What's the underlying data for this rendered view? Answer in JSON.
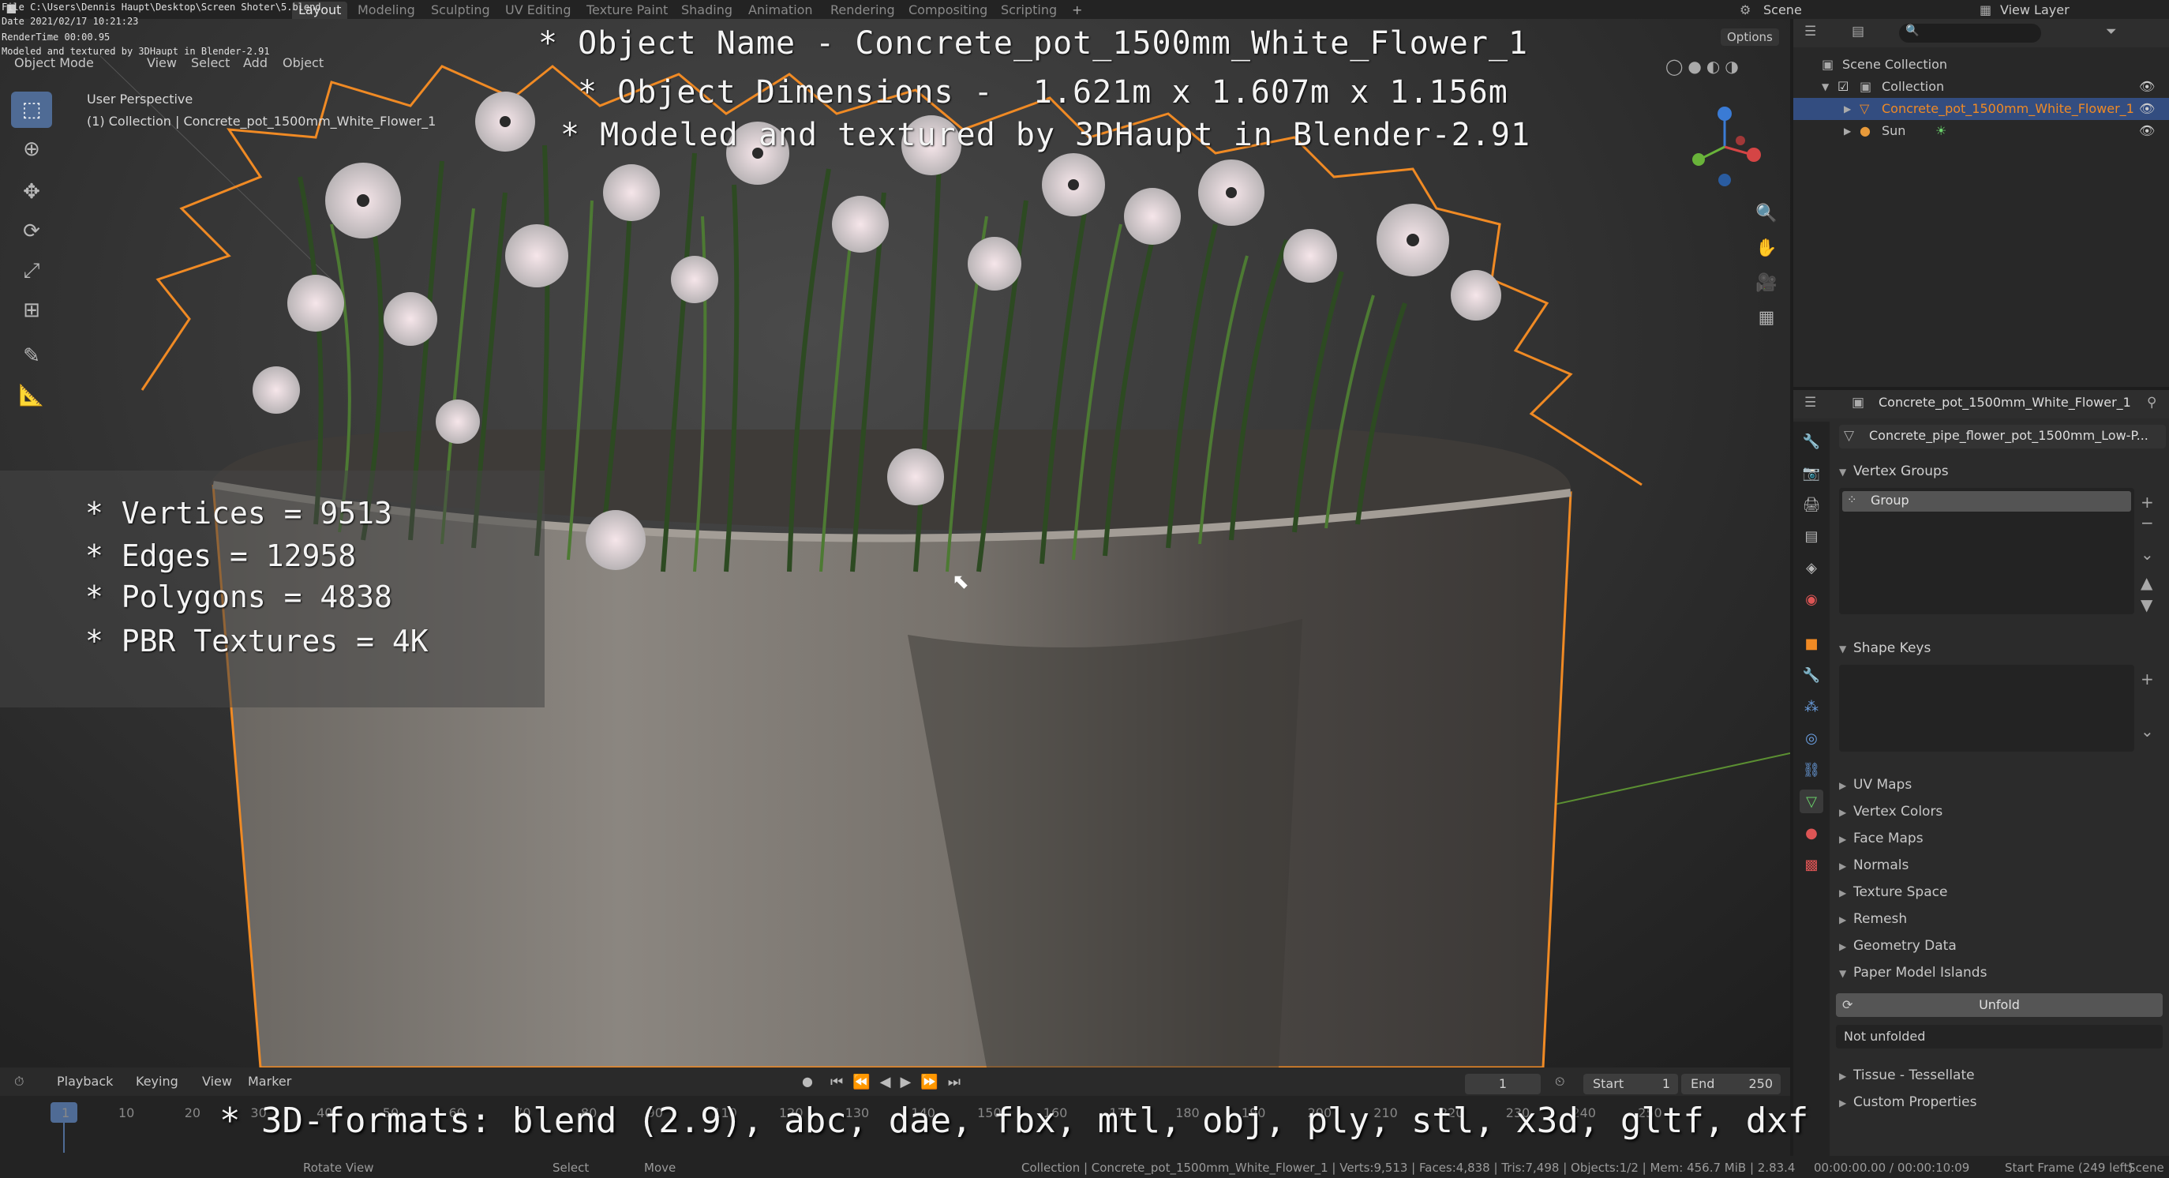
{
  "topbar": {
    "tabs": [
      "Layout",
      "Modeling",
      "Sculpting",
      "UV Editing",
      "Texture Paint",
      "Shading",
      "Animation",
      "Rendering",
      "Compositing",
      "Scripting"
    ],
    "active_tab": "Layout",
    "scene_label": "Scene",
    "view_layer_label": "View Layer"
  },
  "info_overlay": {
    "file": "File C:\\Users\\Dennis Haupt\\Desktop\\Screen Shoter\\5.blend",
    "date": "Date 2021/02/17 10:21:23",
    "render_time": "RenderTime 00:00.95",
    "credit": "Modeled and textured by 3DHaupt in Blender-2.91"
  },
  "viewport": {
    "mode": "Object Mode",
    "menus": [
      "View",
      "Select",
      "Add",
      "Object"
    ],
    "perspective": "User Perspective",
    "collection_path": "(1) Collection | Concrete_pot_1500mm_White_Flower_1",
    "options_label": "Options"
  },
  "overlay_title": {
    "line1": "* Object Name - Concrete_pot_1500mm_White_Flower_1",
    "line2": "* Object Dimensions -  1.621m x 1.607m x 1.156m",
    "line3": "* Modeled and textured by 3DHaupt in Blender-2.91"
  },
  "overlay_stats": {
    "vertices": "* Vertices = 9513",
    "edges": "* Edges = 12958",
    "polygons": "* Polygons = 4838",
    "textures": "* PBR Textures = 4K"
  },
  "overlay_formats": "* 3D-formats: blend (2.9), abc, dae, fbx, mtl, obj, ply, stl, x3d, gltf, dxf",
  "outliner": {
    "root": "Scene Collection",
    "collection": "Collection",
    "object": "Concrete_pot_1500mm_White_Flower_1",
    "light": "Sun"
  },
  "properties": {
    "object_name": "Concrete_pot_1500mm_White_Flower_1",
    "mesh_name": "Concrete_pipe_flower_pot_1500mm_Low-P...",
    "vertex_groups_label": "Vertex Groups",
    "vertex_group_item": "Group",
    "shape_keys_label": "Shape Keys",
    "collapsed_panels": [
      "UV Maps",
      "Vertex Colors",
      "Face Maps",
      "Normals",
      "Texture Space",
      "Remesh",
      "Geometry Data"
    ],
    "paper_model_label": "Paper Model Islands",
    "unfold_button": "Unfold",
    "unfold_status": "Not unfolded",
    "tissue_label": "Tissue - Tessellate",
    "custom_props_label": "Custom Properties"
  },
  "timeline": {
    "menus": [
      "Playback",
      "Keying",
      "View",
      "Marker"
    ],
    "current_frame": "1",
    "start_label": "Start",
    "start_value": "1",
    "end_label": "End",
    "end_value": "250",
    "ticks": [
      "1",
      "10",
      "20",
      "30",
      "40",
      "50",
      "60",
      "70",
      "80",
      "90",
      "110",
      "120",
      "130",
      "140",
      "150",
      "160",
      "170",
      "180",
      "190",
      "200",
      "210",
      "220",
      "230",
      "240",
      "250"
    ]
  },
  "statusbar": {
    "select": "Select",
    "rotate": "Rotate View",
    "move": "Move",
    "stats": "Collection | Concrete_pot_1500mm_White_Flower_1 | Verts:9,513 | Faces:4,838 | Tris:7,498 | Objects:1/2 | Mem: 456.7 MiB | 2.83.4",
    "time": "00:00:00.00 / 00:00:10:09",
    "start_frame": "Start Frame (249 left)",
    "scene": "Scene"
  },
  "colors": {
    "selection_orange": "#f08a24",
    "active_blue": "#4f6b95",
    "outliner_select": "#334d80"
  }
}
